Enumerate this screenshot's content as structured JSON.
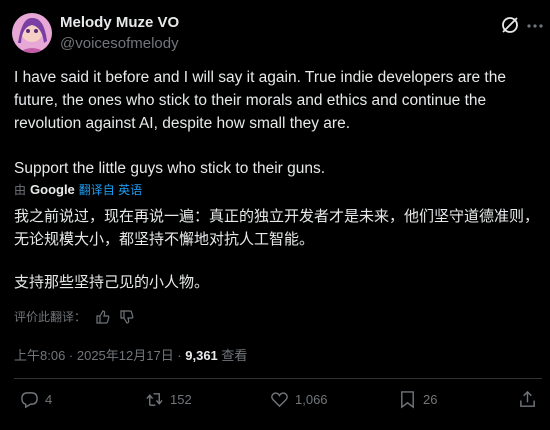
{
  "tweet": {
    "author_name": "Melody Muze VO",
    "author_handle": "@voicesofmelody",
    "text_line1": "I have said it before and I will say it again. True indie developers are the future, the ones who stick to their morals and ethics and continue the revolution against AI, despite how small they are.",
    "text_line2": "Support the little guys who stick to their guns."
  },
  "translation": {
    "by": "由",
    "provider": "Google",
    "link_label": "翻译自 英语",
    "line1": "我之前说过，现在再说一遍：真正的独立开发者才是未来，他们坚守道德准则，无论规模大小，都坚持不懈地对抗人工智能。",
    "line2": "支持那些坚持己见的小人物。",
    "rate_label": "评价此翻译："
  },
  "meta": {
    "time": "上午8:06 · 2025年12月17日 · ",
    "views": "9,361",
    "views_label": " 查看"
  },
  "actions": {
    "reply_count": "4",
    "retweet_count": "152",
    "like_count": "1,066",
    "bookmark_count": "26"
  },
  "colors": {
    "background": "#000000",
    "text": "#e7e9ea",
    "muted": "#71767b",
    "link": "#1d9bf0"
  }
}
